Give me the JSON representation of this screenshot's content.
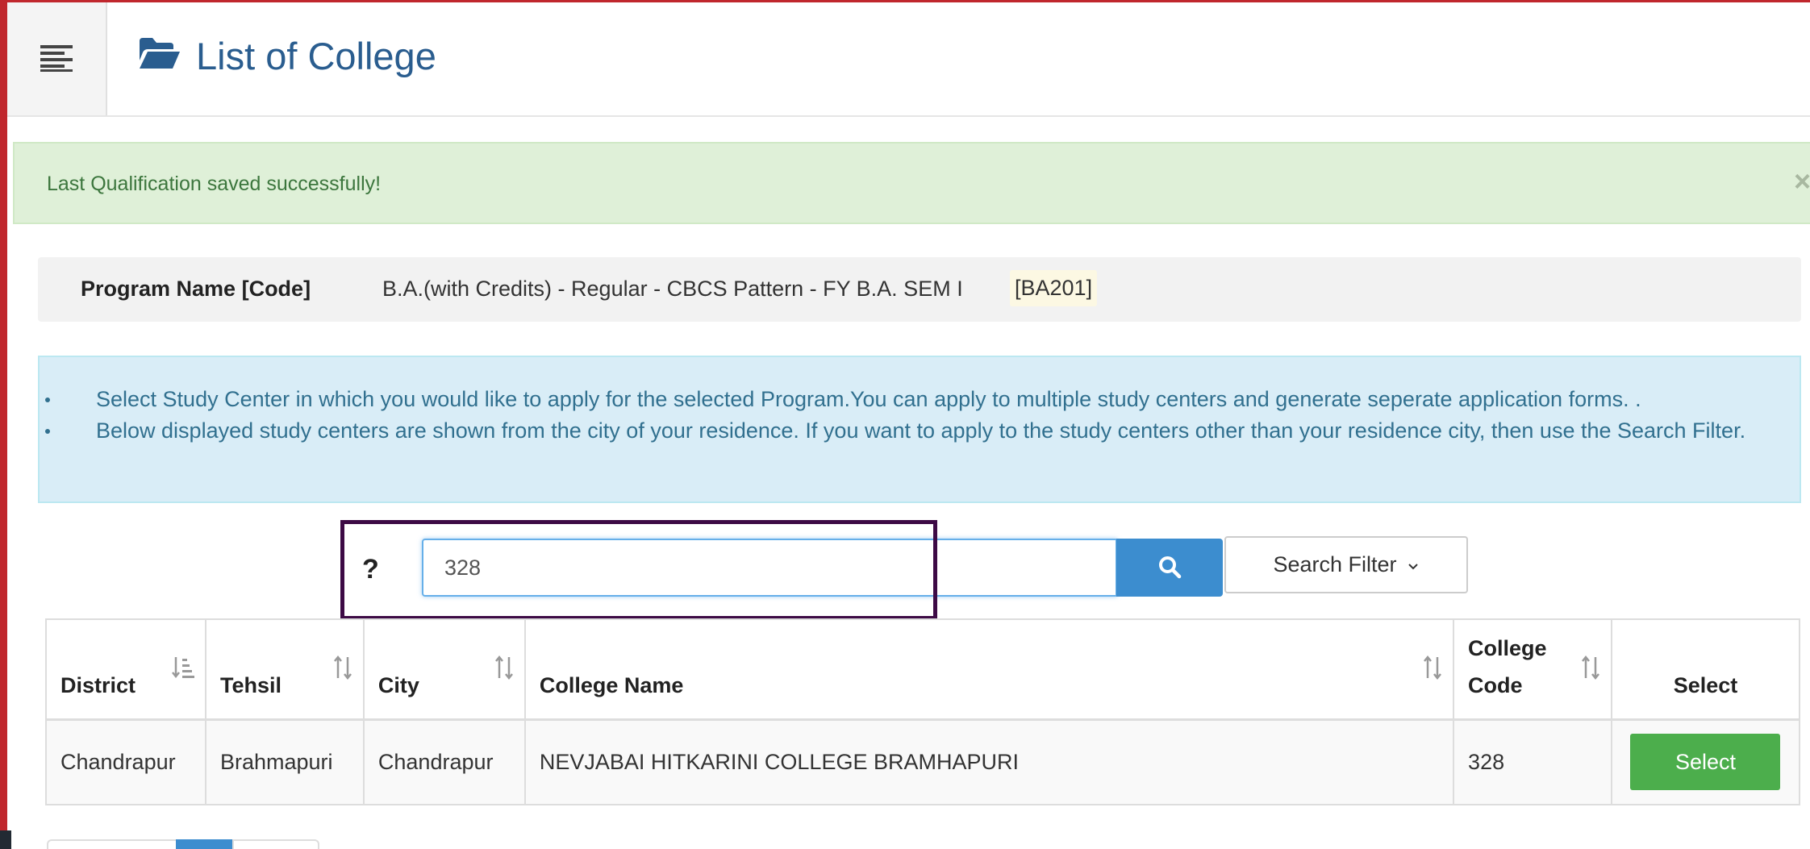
{
  "header": {
    "page_title": "List of College",
    "folder_icon": "folder-open-icon",
    "menu_icon": "hamburger-menu-icon"
  },
  "alert": {
    "message": "Last Qualification saved successfully!",
    "close_label": "×"
  },
  "program": {
    "label": "Program Name [Code]",
    "value": "B.A.(with Credits) - Regular - CBCS Pattern - FY B.A. SEM I",
    "code": "[BA201]"
  },
  "info": {
    "items": [
      "Select Study Center in which you would like to apply for the selected Program.You can apply to multiple study centers and generate seperate application forms. .",
      "Below displayed study centers are shown from the city of your residence. If you want to apply to the study centers other than your residence city, then use the Search Filter."
    ]
  },
  "search": {
    "help_mark": "?",
    "value": "328",
    "button_icon": "search-icon",
    "filter_label": "Search Filter",
    "filter_icon": "chevron-down-icon"
  },
  "table": {
    "headers": {
      "district": "District",
      "tehsil": "Tehsil",
      "city": "City",
      "college_name": "College Name",
      "college_code_line1": "College",
      "college_code_line2": "Code",
      "select": "Select"
    },
    "rows": [
      {
        "district": "Chandrapur",
        "tehsil": "Brahmapuri",
        "city": "Chandrapur",
        "college_name": "NEVJABAI HITKARINI COLLEGE BRAMHAPURI",
        "college_code": "328",
        "select_label": "Select"
      }
    ]
  },
  "colors": {
    "title_blue": "#2a5d8f",
    "success_bg": "#dff0d8",
    "info_bg": "#d9edf7",
    "primary_blue": "#3c8dcf",
    "select_green": "#4cae4c",
    "highlight_box": "#3d0a45",
    "frame_red": "#c0272d"
  }
}
